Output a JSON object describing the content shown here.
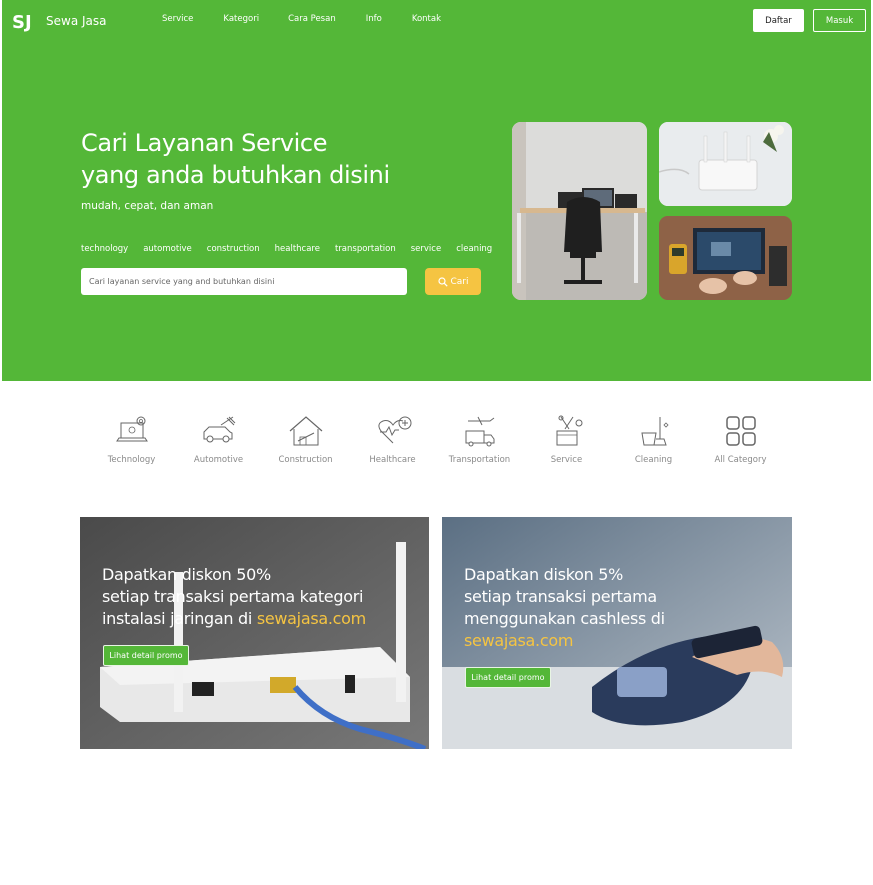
{
  "header": {
    "logo_mark": "SJ",
    "brand": "Sewa Jasa",
    "nav": [
      "Service",
      "Kategori",
      "Cara Pesan",
      "Info",
      "Kontak"
    ],
    "register_label": "Daftar",
    "login_label": "Masuk"
  },
  "hero": {
    "title_line1": "Cari Layanan Service",
    "title_line2": "yang anda butuhkan disini",
    "subtitle": "mudah, cepat, dan aman",
    "tags": [
      "technology",
      "automotive",
      "construction",
      "healthcare",
      "transportation",
      "service",
      "cleaning"
    ],
    "search_placeholder": "Cari layanan service yang and butuhkan disini",
    "search_button": "Cari"
  },
  "categories": [
    {
      "label": "Technology",
      "icon": "laptop-gear-icon"
    },
    {
      "label": "Automotive",
      "icon": "car-wrench-icon"
    },
    {
      "label": "Construction",
      "icon": "house-icon"
    },
    {
      "label": "Healthcare",
      "icon": "heart-plus-icon"
    },
    {
      "label": "Transportation",
      "icon": "plane-truck-icon"
    },
    {
      "label": "Service",
      "icon": "tools-box-icon"
    },
    {
      "label": "Cleaning",
      "icon": "bucket-mop-icon"
    },
    {
      "label": "All Category",
      "icon": "grid-icon"
    }
  ],
  "promos": [
    {
      "line1": "Dapatkan diskon 50%",
      "line2": "setiap transaksi pertama kategori",
      "line3_prefix": "instalasi jaringan di ",
      "highlight": "sewajasa.com",
      "button": "Lihat detail promo"
    },
    {
      "line1": "Dapatkan diskon 5%",
      "line2": "setiap transaksi pertama",
      "line3": "menggunakan cashless di",
      "highlight": "sewajasa.com",
      "button": "Lihat detail promo"
    }
  ],
  "colors": {
    "brand_green": "#54b738",
    "accent_yellow": "#f5c442"
  }
}
